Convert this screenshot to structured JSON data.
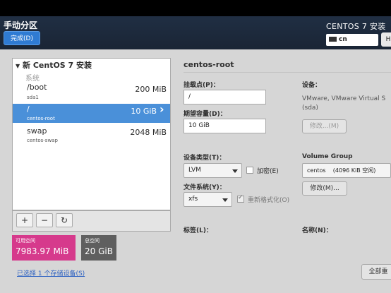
{
  "header": {
    "title": "手动分区",
    "done_button": "完成(D)",
    "product": "CENTOS 7 安装",
    "keyboard_layout": "cn",
    "help_button": "H"
  },
  "tree": {
    "group_title": "新 CentOS 7 安装",
    "system_label": "系统",
    "items": [
      {
        "name": "/boot",
        "device": "sda1",
        "size": "200 MiB"
      },
      {
        "name": "/",
        "device": "centos-root",
        "size": "10 GiB"
      },
      {
        "name": "swap",
        "device": "centos-swap",
        "size": "2048 MiB"
      }
    ],
    "selected_chevron": "›"
  },
  "controls": {
    "add": "+",
    "remove": "−",
    "refresh": "↻"
  },
  "space": {
    "available_label": "可用空间",
    "available_value": "7983.97 MiB",
    "total_label": "总空间",
    "total_value": "20 GiB"
  },
  "storage_link": "已选择 1 个存储设备(S)",
  "detail": {
    "title": "centos-root",
    "mount_label": "挂载点(P)：",
    "mount_value": "/",
    "capacity_label": "期望容量(D)：",
    "capacity_value": "10 GiB",
    "device_label": "设备：",
    "device_value": "VMware, VMware Virtual S (sda)",
    "modify_device_button": "修改...(M)",
    "device_type_label": "设备类型(T)：",
    "device_type_value": "LVM",
    "encrypt_label": "加密(E)",
    "volume_group_label": "Volume Group",
    "volume_group_value": "centos",
    "volume_group_free": "(4096 KiB 空闲)",
    "filesystem_label": "文件系统(Y)：",
    "filesystem_value": "xfs",
    "reformat_label": "重新格式化(O)",
    "modify_vg_button": "修改(M)...",
    "tag_label": "标签(L)：",
    "name_label": "名称(N)："
  },
  "reset_button": "全部重"
}
